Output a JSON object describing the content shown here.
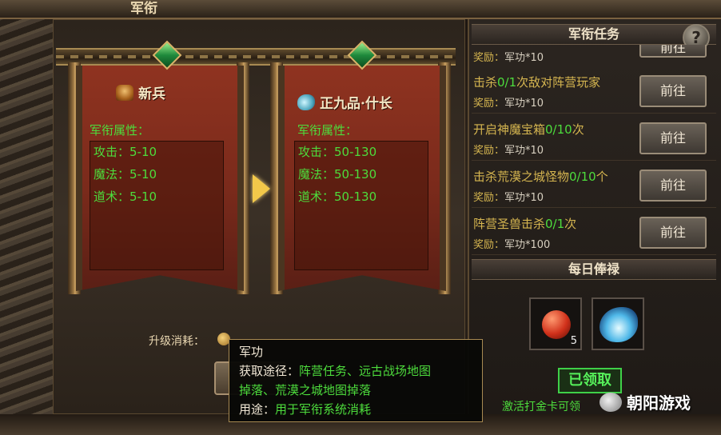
{
  "window": {
    "title": "军衔"
  },
  "ranks": {
    "current": {
      "name": "新兵",
      "attr_title": "军衔属性：",
      "attrs": [
        "攻击：5-10",
        "魔法：5-10",
        "道术：5-10"
      ]
    },
    "next": {
      "name": "正九品·什长",
      "attr_title": "军衔属性：",
      "attrs": [
        "攻击：50-130",
        "魔法：50-130",
        "道术：50-130"
      ]
    }
  },
  "upgrade": {
    "cost_label": "升级消耗：",
    "button_label": ""
  },
  "tasks_panel": {
    "title": "军衔任务",
    "help_label": "?",
    "tasks": [
      {
        "name": "",
        "progress": "",
        "suffix": "",
        "reward_label": "奖励：",
        "reward": "军功*10",
        "button": "前往"
      },
      {
        "name": "击杀",
        "progress": "0/1",
        "suffix": "次敌对阵营玩家",
        "reward_label": "奖励：",
        "reward": "军功*10",
        "button": "前往"
      },
      {
        "name": "开启神魔宝箱",
        "progress": "0/10",
        "suffix": "次",
        "reward_label": "奖励：",
        "reward": "军功*10",
        "button": "前往"
      },
      {
        "name": "击杀荒漠之城怪物",
        "progress": "0/10",
        "suffix": "个",
        "reward_label": "奖励：",
        "reward": "军功*10",
        "button": "前往"
      },
      {
        "name": "阵营圣兽击杀",
        "progress": "0/1",
        "suffix": "次",
        "reward_label": "奖励：",
        "reward": "军功*100",
        "button": "前往"
      }
    ]
  },
  "daily": {
    "title": "每日俸禄",
    "items": [
      {
        "icon": "red-orb-icon",
        "count": "5"
      },
      {
        "icon": "blue-wing-icon",
        "count": ""
      }
    ],
    "claimed_label": "已领取",
    "activate_text": "激活打金卡可领"
  },
  "tooltip": {
    "title": "军功",
    "source_label": "获取途径：",
    "source_value_1": "阵营任务、远古战场地图",
    "source_value_2": "掉落、荒漠之城地图掉落",
    "use_label": "用途：",
    "use_value": "用于军衔系统消耗"
  },
  "watermark": {
    "text": "朝阳游戏"
  },
  "colors": {
    "green_text": "#4ddc3c",
    "gold_text": "#d6b650",
    "banner_red": "#8f3320"
  }
}
